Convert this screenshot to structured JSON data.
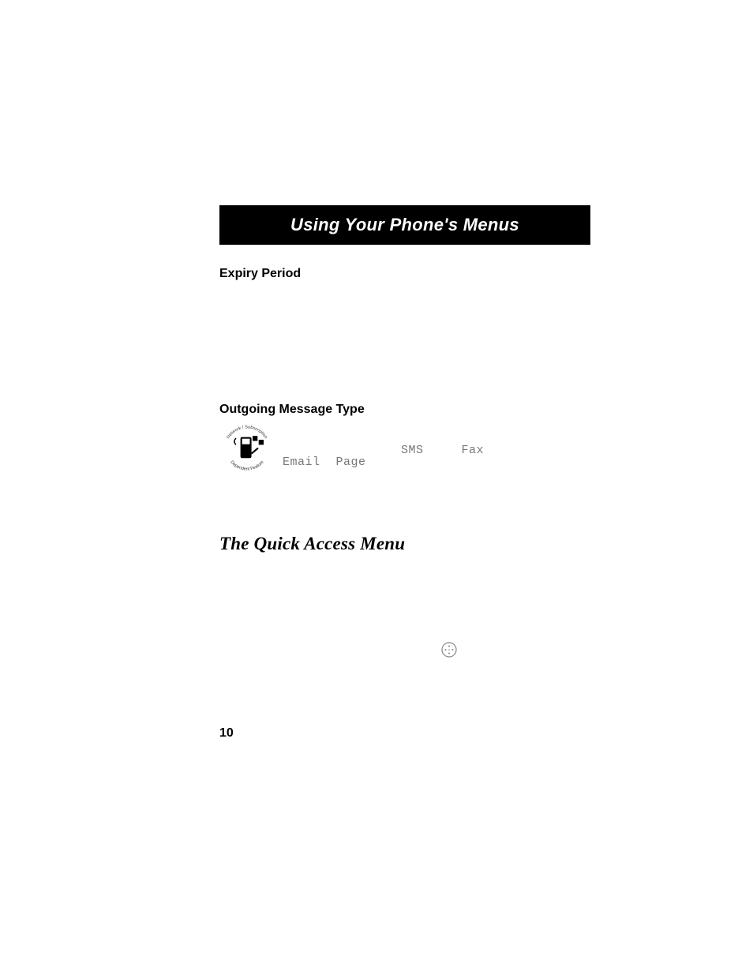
{
  "header": {
    "chapter_title": "Using Your Phone's Menus"
  },
  "sections": {
    "expiry": {
      "heading": "Expiry Period"
    },
    "outgoing": {
      "heading": "Outgoing Message Type",
      "badge_top": "Network / Subscription",
      "badge_bottom": "Dependent Feature",
      "type_sms": "SMS",
      "type_fax": "Fax",
      "type_email": "Email",
      "type_page": "Page"
    },
    "quick_access": {
      "heading": "The Quick Access Menu"
    }
  },
  "page_number": "10"
}
